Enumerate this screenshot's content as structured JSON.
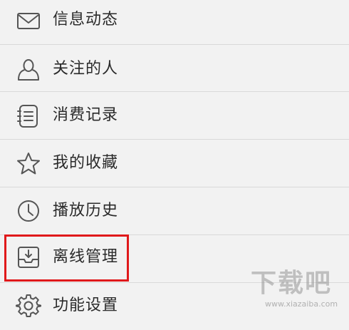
{
  "menu": {
    "items": [
      {
        "label": "信息动态",
        "icon": "envelope-icon"
      },
      {
        "label": "关注的人",
        "icon": "person-icon"
      },
      {
        "label": "消费记录",
        "icon": "notebook-icon"
      },
      {
        "label": "我的收藏",
        "icon": "star-icon"
      },
      {
        "label": "播放历史",
        "icon": "clock-icon"
      },
      {
        "label": "离线管理",
        "icon": "download-tray-icon"
      },
      {
        "label": "功能设置",
        "icon": "gear-icon"
      }
    ]
  },
  "highlight": {
    "color": "#e0191b",
    "target": "离线管理"
  },
  "watermark": {
    "main": "下载吧",
    "sub": "www.xiazaiba.com"
  },
  "colors": {
    "background": "#f2f2f2",
    "text": "#2a2a2a",
    "icon": "#555555",
    "divider": "#d9d9d9"
  }
}
